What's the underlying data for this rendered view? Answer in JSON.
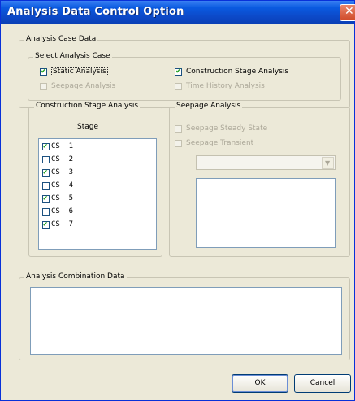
{
  "window": {
    "title": "Analysis Data Control Option"
  },
  "analysis_case": {
    "group_label": "Analysis Case Data",
    "select_label": "Select Analysis Case",
    "options": {
      "static": {
        "label": "Static Analysis",
        "checked": true,
        "enabled": true
      },
      "construction": {
        "label": "Construction Stage Analysis",
        "checked": true,
        "enabled": true
      },
      "seepage": {
        "label": "Seepage Analysis",
        "checked": false,
        "enabled": false
      },
      "time_history": {
        "label": "Time History Analysis",
        "checked": false,
        "enabled": false
      }
    }
  },
  "construction_stage": {
    "group_label": "Construction Stage Analysis",
    "column_header": "Stage",
    "stages": [
      {
        "label": "CS  1",
        "checked": true
      },
      {
        "label": "CS  2",
        "checked": false
      },
      {
        "label": "CS  3",
        "checked": true
      },
      {
        "label": "CS  4",
        "checked": false
      },
      {
        "label": "CS  5",
        "checked": true
      },
      {
        "label": "CS  6",
        "checked": false
      },
      {
        "label": "CS  7",
        "checked": true
      }
    ]
  },
  "seepage_analysis": {
    "group_label": "Seepage Analysis",
    "steady_state": {
      "label": "Seepage Steady State",
      "checked": false
    },
    "transient": {
      "label": "Seepage Transient",
      "checked": false
    },
    "dropdown_value": ""
  },
  "combination": {
    "group_label": "Analysis Combination Data"
  },
  "buttons": {
    "ok": "OK",
    "cancel": "Cancel"
  },
  "colors": {
    "titlebar": "#0a5ae0",
    "dialog_bg": "#ece9d8",
    "check_tick": "#21a121",
    "disabled_text": "#aca899"
  }
}
